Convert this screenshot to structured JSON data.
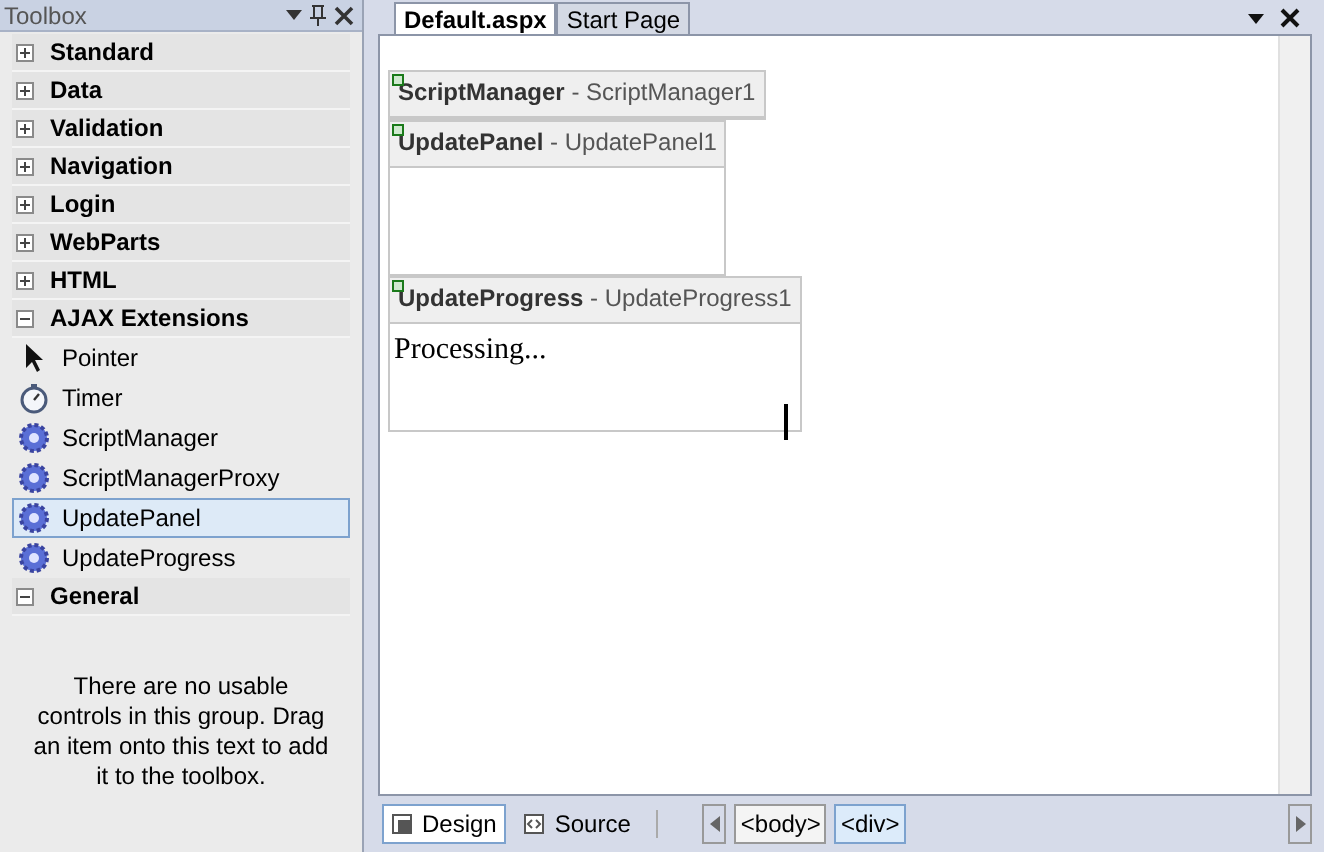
{
  "toolbox": {
    "title": "Toolbox",
    "categories": [
      {
        "label": "Standard",
        "expanded": false
      },
      {
        "label": "Data",
        "expanded": false
      },
      {
        "label": "Validation",
        "expanded": false
      },
      {
        "label": "Navigation",
        "expanded": false
      },
      {
        "label": "Login",
        "expanded": false
      },
      {
        "label": "WebParts",
        "expanded": false
      },
      {
        "label": "HTML",
        "expanded": false
      },
      {
        "label": "AJAX Extensions",
        "expanded": true,
        "items": [
          {
            "label": "Pointer",
            "kind": "pointer",
            "selected": false
          },
          {
            "label": "Timer",
            "kind": "timer",
            "selected": false
          },
          {
            "label": "ScriptManager",
            "kind": "gear",
            "selected": false
          },
          {
            "label": "ScriptManagerProxy",
            "kind": "gear",
            "selected": false
          },
          {
            "label": "UpdatePanel",
            "kind": "gear",
            "selected": true
          },
          {
            "label": "UpdateProgress",
            "kind": "gear",
            "selected": false
          }
        ]
      },
      {
        "label": "General",
        "expanded": true,
        "message": "There are no usable controls in this group. Drag an item onto this text to add it to the toolbox."
      }
    ]
  },
  "editor": {
    "tabs": [
      {
        "label": "Default.aspx",
        "selected": true
      },
      {
        "label": "Start Page",
        "selected": false
      }
    ],
    "controls": [
      {
        "header": "**ScriptManager** - ScriptManager1",
        "kind": "bar"
      },
      {
        "header": "**UpdatePanel** - UpdatePanel1",
        "kind": "panel"
      },
      {
        "header": "**UpdateProgress** - UpdateProgress1",
        "kind": "panel",
        "body": "Processing..."
      }
    ],
    "views": [
      {
        "label": "Design",
        "kind": "design",
        "selected": true
      },
      {
        "label": "Source",
        "kind": "source",
        "selected": false
      }
    ],
    "tags": [
      {
        "label": "<body>",
        "selected": false
      },
      {
        "label": "<div>",
        "selected": true
      }
    ]
  }
}
